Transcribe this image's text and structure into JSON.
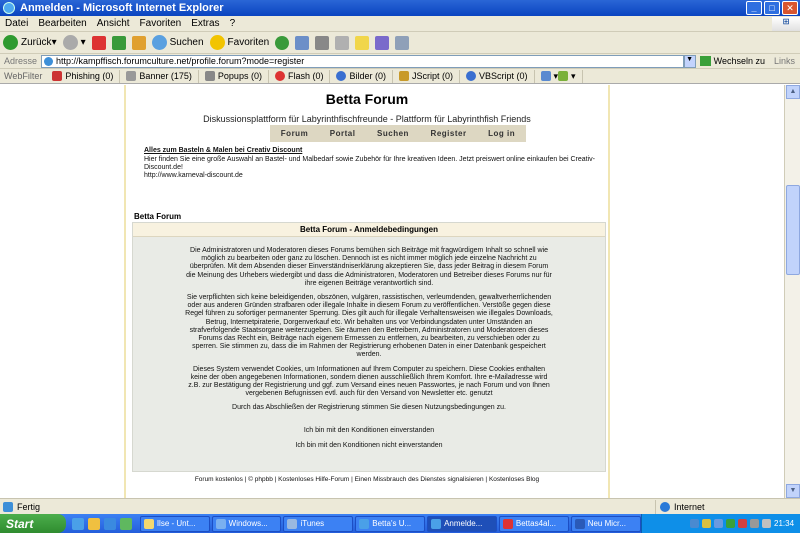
{
  "window": {
    "title": "Anmelden - Microsoft Internet Explorer"
  },
  "menu": [
    "Datei",
    "Bearbeiten",
    "Ansicht",
    "Favoriten",
    "Extras",
    "?"
  ],
  "toolbar": {
    "back": "Zurück",
    "search": "Suchen",
    "favorites": "Favoriten"
  },
  "address": {
    "label": "Adresse",
    "url": "http://kampffisch.forumculture.net/profile.forum?mode=register",
    "go": "Wechseln zu",
    "links": "Links"
  },
  "webfilter": {
    "label": "WebFilter",
    "items": [
      "Phishing (0)",
      "Banner (175)",
      "Popups (0)",
      "Flash (0)",
      "Bilder (0)",
      "JScript (0)",
      "VBScript (0)"
    ]
  },
  "page": {
    "title": "Betta Forum",
    "subtitle": "Diskussionsplattform für Labyrinthfischfreunde - Plattform für Labyrinthfish Friends",
    "nav": [
      "Forum",
      "Portal",
      "Suchen",
      "Register",
      "Log in"
    ],
    "ad": {
      "heading": "Alles zum Basteln & Malen bei Creativ Discount",
      "text": "Hier finden Sie eine große Auswahl an Bastel- und Malbedarf sowie Zubehör für Ihre kreativen Ideen. Jetzt preiswert online einkaufen bei Creativ-Discount.de!",
      "url": "http://www.karneval-discount.de"
    },
    "section_label": "Betta Forum",
    "box_title": "Betta Forum - Anmeldebedingungen",
    "paragraphs": [
      "Die Administratoren und Moderatoren dieses Forums bemühen sich Beiträge mit fragwürdigem Inhalt so schnell wie möglich zu bearbeiten oder ganz zu löschen. Dennoch ist es nicht immer möglich jede einzelne Nachricht zu überprüfen. Mit dem Absenden dieser Einverständniserklärung akzeptieren Sie, dass jeder Beitrag in diesem Forum die Meinung des Urhebers wiedergibt und dass die Administratoren, Moderatoren und Betreiber dieses Forums nur für ihre eigenen Beiträge verantwortlich sind.",
      "Sie verpflichten sich keine beleidigenden, obszönen, vulgären, rassistischen, verleumdenden, gewaltverherrlichenden oder aus anderen Gründen strafbaren oder illegale Inhalte in diesem Forum zu veröffentlichen. Verstöße gegen diese Regel führen zu sofortiger permanenter Sperrung. Dies gilt auch für illegale Verhaltensweisen wie illegales Downloads, Betrug, Internetpiraterie, Dorgenverkauf etc. Wir behalten uns vor Verbindungsdaten unter Umständen an strafverfolgende Staatsorgane weiterzugeben. Sie räumen den Betreibern, Administratoren und Moderatoren dieses Forums das Recht ein, Beiträge nach eigenem Ermessen zu entfernen, zu bearbeiten, zu verschieben oder zu sperren. Sie stimmen zu, dass die im Rahmen der Registrierung erhobenen Daten in einer Datenbank gespeichert werden.",
      "Dieses System verwendet Cookies, um Informationen auf Ihrem Computer zu speichern. Diese Cookies enthalten keine der oben angegebenen Informationen, sondern dienen ausschließlich Ihrem Komfort. Ihre e-Mailadresse wird z.B. zur Bestätigung der Registrierung und ggf. zum Versand eines neuen Passwortes, je nach Forum und von Ihnen vergebenen Befugnissen evtl. auch für den Versand von Newsletter etc. genutzt",
      "Durch das Abschließen der Registrierung stimmen Sie diesen Nutzungsbedingungen zu."
    ],
    "agree": "Ich bin mit den Konditionen einverstanden",
    "disagree": "Ich bin mit den Konditionen nicht einverstanden",
    "footer": [
      "Forum kostenlos",
      "©  phpbb",
      "Kostenloses Hilfe-Forum",
      "Einen Missbrauch des Dienstes signalisieren",
      "Kostenloses Blog"
    ]
  },
  "status": {
    "text": "Fertig",
    "zone": "Internet"
  },
  "taskbar": {
    "start": "Start",
    "tasks": [
      "Ilse - Unt...",
      "Windows...",
      "iTunes",
      "Betta's U...",
      "Anmelde...",
      "Bettas4al...",
      "Neu Micr..."
    ],
    "clock": "21:34"
  }
}
